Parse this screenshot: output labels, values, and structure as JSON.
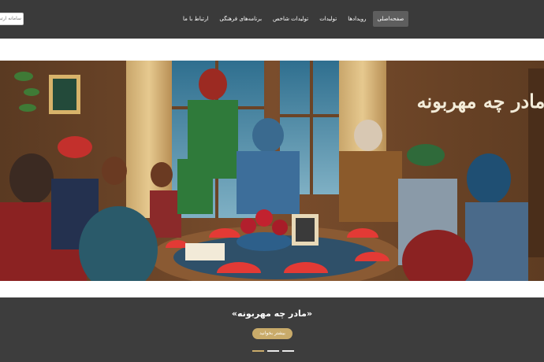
{
  "header": {
    "search": {
      "placeholder": "سامانه ارتباط"
    },
    "nav": [
      {
        "label": "صفحه‌اصلی",
        "active": true
      },
      {
        "label": "رویدادها",
        "active": false
      },
      {
        "label": "تولیدات",
        "active": false
      },
      {
        "label": "تولیدات شاخص",
        "active": false
      },
      {
        "label": "برنامه‌های فرهنگی",
        "active": false
      },
      {
        "label": "ارتباط با ما",
        "active": false
      }
    ]
  },
  "slider": {
    "banner": {
      "calligraphy": "مادر چه مهربونه",
      "scene": "family-yalda-night-gathering"
    },
    "caption": "«مادر چه مهربونه»",
    "cta_label": "بیشتر بخوانید",
    "slide_count": 3,
    "active_slide": 1
  },
  "colors": {
    "navbar": "#3a3a3a",
    "nav_active": "#5e5e5e",
    "caption_bar": "#3d3d3d",
    "accent_gold": "#c9ab6a",
    "banner_wall": "#7a4d2c"
  }
}
